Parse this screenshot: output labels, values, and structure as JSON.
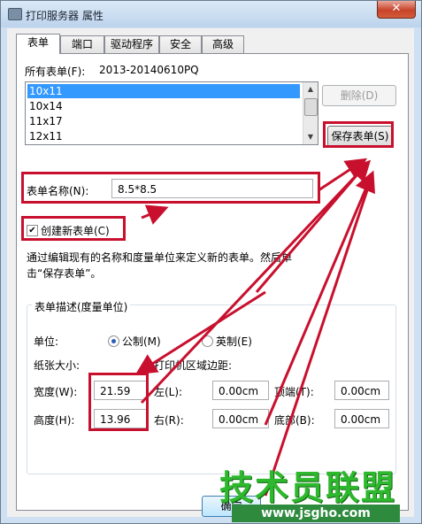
{
  "window": {
    "title": "打印服务器 属性",
    "close_glyph": "✕"
  },
  "tabs": [
    "表单",
    "端口",
    "驱动程序",
    "安全",
    "高级"
  ],
  "forms": {
    "all_forms_label": "所有表单(F):",
    "server_name": "2013-20140610PQ",
    "list": [
      "10x11",
      "10x14",
      "11x17",
      "12x11"
    ],
    "selected_index": 0,
    "delete_button": "删除(D)",
    "save_button": "保存表单(S)",
    "form_name_label": "表单名称(N):",
    "form_name_value": "8.5*8.5",
    "create_new_label": "创建新表单(C)",
    "create_new_checked": true,
    "description": "通过编辑现有的名称和度量单位来定义新的表单。然后单击“保存表单”。"
  },
  "description_group": {
    "title": "表单描述(度量单位)",
    "units_label": "单位:",
    "metric_label": "公制(M)",
    "english_label": "英制(E)",
    "unit_selected": "metric",
    "paper_size_label": "纸张大小:",
    "margins_label": "打印机区域边距:",
    "width_label": "宽度(W):",
    "width_value": "21.59",
    "height_label": "高度(H):",
    "height_value": "13.96",
    "left_label": "左(L):",
    "left_value": "0.00cm",
    "right_label": "右(R):",
    "right_value": "0.00cm",
    "top_label": "顶端(T):",
    "top_value": "0.00cm",
    "bottom_label": "底部(B):",
    "bottom_value": "0.00cm"
  },
  "footer": {
    "ok_button": "确定"
  },
  "watermark": {
    "brand": "技术员联盟",
    "url": "www.jsgho.com"
  },
  "colors": {
    "annotation_red": "#c8102e",
    "selection_blue": "#3399ff",
    "watermark_green": "#2eb82e"
  }
}
